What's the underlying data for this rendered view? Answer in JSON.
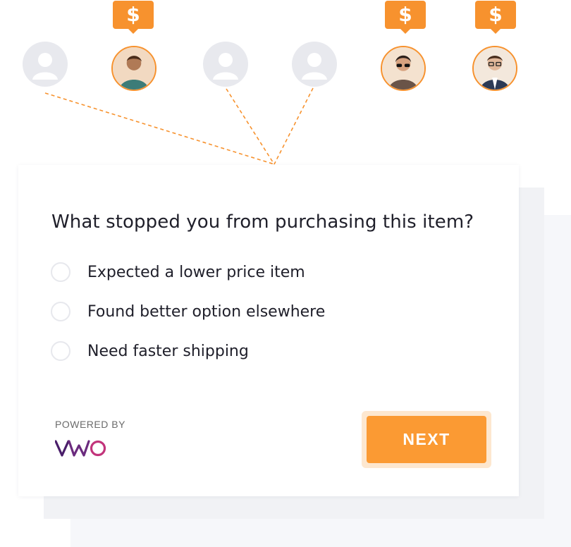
{
  "users": [
    {
      "id": "u1",
      "type": "placeholder",
      "purchased": false
    },
    {
      "id": "u2",
      "type": "photo",
      "purchased": true,
      "price_tag": "$"
    },
    {
      "id": "u3",
      "type": "placeholder",
      "purchased": false
    },
    {
      "id": "u4",
      "type": "placeholder",
      "purchased": false
    },
    {
      "id": "u5",
      "type": "photo",
      "purchased": true,
      "price_tag": "$"
    },
    {
      "id": "u6",
      "type": "photo",
      "purchased": true,
      "price_tag": "$"
    }
  ],
  "survey": {
    "question": "What stopped you from purchasing this item?",
    "options": [
      "Expected a lower price item",
      "Found better option elsewhere",
      "Need faster shipping"
    ],
    "next_label": "NEXT"
  },
  "branding": {
    "powered_by": "POWERED BY",
    "logo_text": "VWO"
  },
  "colors": {
    "accent": "#f7922e",
    "button": "#fb9a33",
    "placeholder": "#e8e9ee",
    "text": "#1f1f2a",
    "logo_primary": "#4a1e6a",
    "logo_secondary": "#c2347b"
  }
}
